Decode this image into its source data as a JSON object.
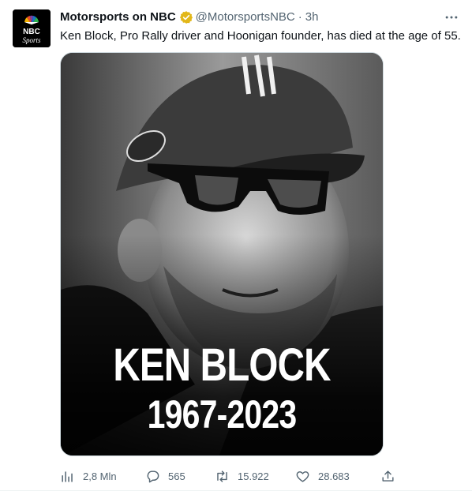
{
  "tweet": {
    "author": {
      "display_name": "Motorsports on NBC",
      "handle": "@MotorsportsNBC",
      "separator": "·",
      "time": "3h",
      "avatar_lines": [
        "NBC",
        "Sports"
      ]
    },
    "text": "Ken Block, Pro Rally driver and Hoonigan founder, has died at the age of 55.",
    "media": {
      "title": "KEN BLOCK",
      "years": "1967-2023"
    },
    "actions": {
      "views": "2,8 Mln",
      "replies": "565",
      "retweets": "15.922",
      "likes": "28.683"
    }
  },
  "icons": {
    "verified": "verified-badge-icon",
    "more": "more-horizontal-icon",
    "views": "analytics-icon",
    "reply": "reply-icon",
    "retweet": "retweet-icon",
    "like": "heart-icon",
    "share": "share-icon"
  },
  "colors": {
    "text": "#0f1419",
    "secondary": "#536471",
    "verified_gold": "#e2b719",
    "nbc_peacock": [
      "#f4b400",
      "#e84a2c",
      "#7b3fa0",
      "#1a73c9",
      "#2bb24c",
      "#fbbc04"
    ]
  }
}
